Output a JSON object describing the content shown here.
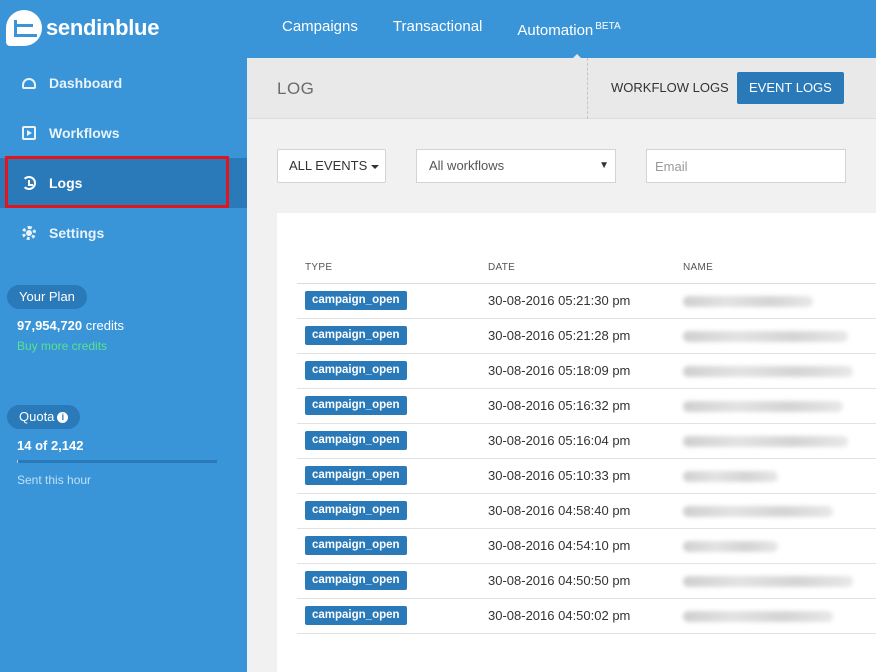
{
  "brand": {
    "name": "sendinblue"
  },
  "topnav": [
    {
      "label": "Campaigns"
    },
    {
      "label": "Transactional"
    },
    {
      "label": "Automation",
      "badge": "BETA"
    }
  ],
  "sidebar": {
    "items": [
      {
        "label": "Dashboard",
        "icon": "dashboard-icon"
      },
      {
        "label": "Workflows",
        "icon": "play-square-icon"
      },
      {
        "label": "Logs",
        "icon": "history-icon",
        "active": true
      },
      {
        "label": "Settings",
        "icon": "gear-icon"
      }
    ],
    "plan": {
      "label": "Your Plan",
      "credits_value": "97,954,720",
      "credits_unit": " credits",
      "buy_link": "Buy more credits"
    },
    "quota": {
      "label": "Quota",
      "info_icon": "i",
      "count": "14 of 2,142",
      "used_fraction": 0.0065,
      "subtitle": "Sent this hour"
    }
  },
  "main": {
    "title": "LOG",
    "buttons": {
      "workflow_logs": "WORKFLOW LOGS",
      "event_logs": "EVENT LOGS"
    },
    "filters": {
      "events_label": "ALL EVENTS",
      "workflow_select": "All workflows",
      "select_arrow": "▼",
      "email_placeholder": "Email"
    },
    "table": {
      "headers": {
        "type": "TYPE",
        "date": "DATE",
        "name": "NAME"
      },
      "rows": [
        {
          "type": "campaign_open",
          "date": "30-08-2016 05:21:30 pm"
        },
        {
          "type": "campaign_open",
          "date": "30-08-2016 05:21:28 pm"
        },
        {
          "type": "campaign_open",
          "date": "30-08-2016 05:18:09 pm"
        },
        {
          "type": "campaign_open",
          "date": "30-08-2016 05:16:32 pm"
        },
        {
          "type": "campaign_open",
          "date": "30-08-2016 05:16:04 pm"
        },
        {
          "type": "campaign_open",
          "date": "30-08-2016 05:10:33 pm"
        },
        {
          "type": "campaign_open",
          "date": "30-08-2016 04:58:40 pm"
        },
        {
          "type": "campaign_open",
          "date": "30-08-2016 04:54:10 pm"
        },
        {
          "type": "campaign_open",
          "date": "30-08-2016 04:50:50 pm"
        },
        {
          "type": "campaign_open",
          "date": "30-08-2016 04:50:02 pm"
        }
      ]
    }
  },
  "colors": {
    "brand_blue": "#3a95d8",
    "active_blue": "#2a79b8",
    "highlight_red": "#e2141c",
    "link_green": "#57e28e"
  }
}
